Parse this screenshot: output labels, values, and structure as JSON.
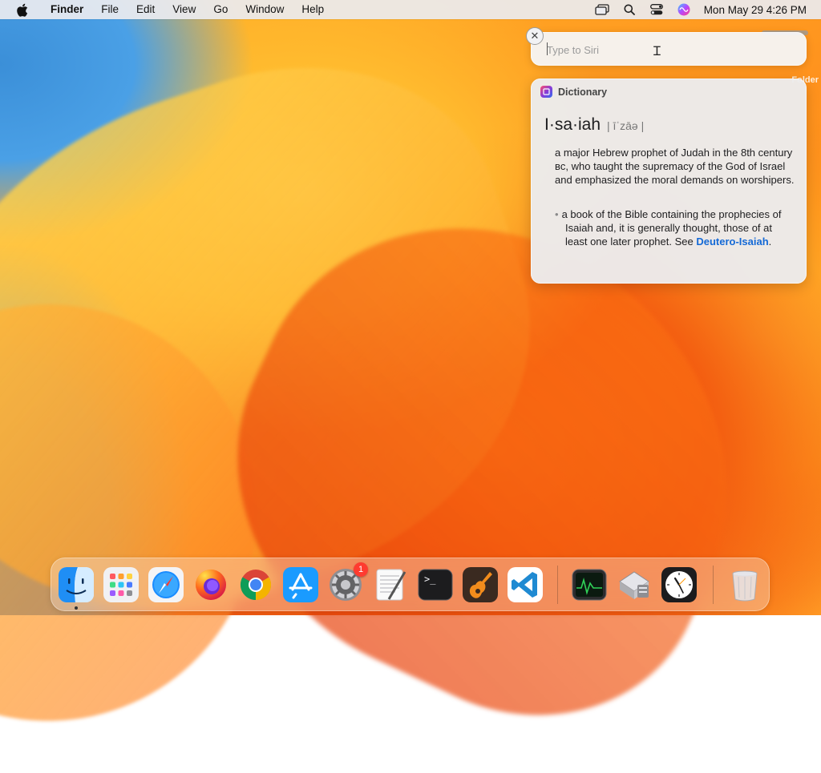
{
  "menubar": {
    "app_name": "Finder",
    "menus": [
      "File",
      "Edit",
      "View",
      "Go",
      "Window",
      "Help"
    ],
    "clock": "Mon May 29  4:26 PM",
    "status_icons": [
      "screen-mirroring-icon",
      "spotlight-search-icon",
      "control-center-icon",
      "siri-icon"
    ]
  },
  "siri": {
    "placeholder": "Type to Siri",
    "value": ""
  },
  "dictionary": {
    "source": "Dictionary",
    "headword": "I·sa·iah",
    "pronunciation": "| īˈzāə |",
    "definition_1": "a major Hebrew prophet of Judah in the 8th century ʙᴄ, who taught the supremacy of the God of Israel and emphasized the moral demands on worshipers.",
    "definition_2_prefix": "a book of the Bible containing the prophecies of Isaiah and, it is generally thought, those of at least one later prophet. See ",
    "definition_2_link": "Deutero-Isaiah",
    "definition_2_suffix": "."
  },
  "desktop": {
    "partial_label": "Folder"
  },
  "dock": {
    "items": [
      {
        "name": "Finder",
        "icon": "finder-icon",
        "running": true
      },
      {
        "name": "Launchpad",
        "icon": "launchpad-icon"
      },
      {
        "name": "Safari",
        "icon": "safari-icon"
      },
      {
        "name": "Firefox",
        "icon": "firefox-icon"
      },
      {
        "name": "Chrome",
        "icon": "chrome-icon"
      },
      {
        "name": "App Store",
        "icon": "app-store-icon"
      },
      {
        "name": "System Settings",
        "icon": "system-settings-icon",
        "badge": "1"
      },
      {
        "name": "TextEdit",
        "icon": "textedit-icon"
      },
      {
        "name": "Terminal",
        "icon": "terminal-icon"
      },
      {
        "name": "GarageBand",
        "icon": "garageband-icon"
      },
      {
        "name": "Visual Studio Code",
        "icon": "vscode-icon"
      },
      {
        "name": "Activity Monitor",
        "icon": "activity-monitor-icon"
      },
      {
        "name": "Migration Assistant",
        "icon": "migration-assistant-icon"
      },
      {
        "name": "Clock",
        "icon": "clock-icon"
      },
      {
        "name": "Trash",
        "icon": "trash-icon"
      }
    ],
    "terminal_prompt": ">_"
  },
  "colors": {
    "accent_link": "#1469d6",
    "badge": "#ff3b30"
  }
}
